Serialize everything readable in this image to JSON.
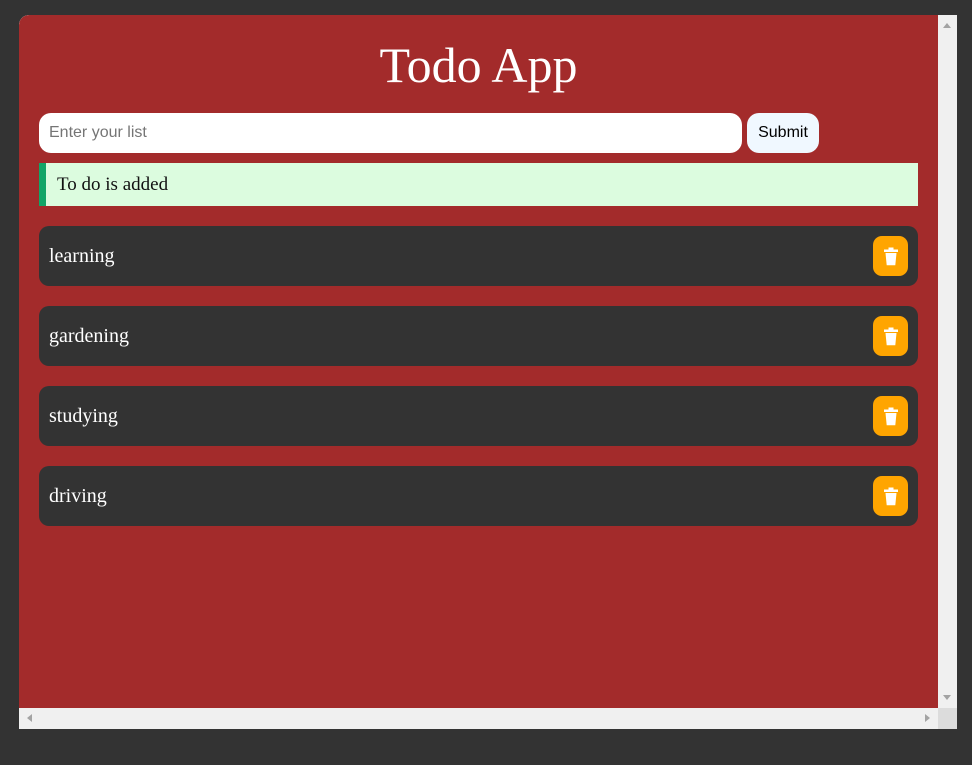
{
  "app": {
    "title": "Todo App"
  },
  "form": {
    "input_value": "",
    "input_placeholder": "Enter your list",
    "submit_label": "Submit"
  },
  "alert": {
    "message": "To do is added",
    "type": "success"
  },
  "todos": [
    {
      "label": "learning",
      "delete_icon": "trash-icon"
    },
    {
      "label": "gardening",
      "delete_icon": "trash-icon"
    },
    {
      "label": "studying",
      "delete_icon": "trash-icon"
    },
    {
      "label": "driving",
      "delete_icon": "trash-icon"
    }
  ],
  "colors": {
    "background": "#a32b2b",
    "item_background": "#333333",
    "delete_button": "#ffa500",
    "alert_background": "#dcfcdf",
    "alert_border": "#12a567"
  }
}
